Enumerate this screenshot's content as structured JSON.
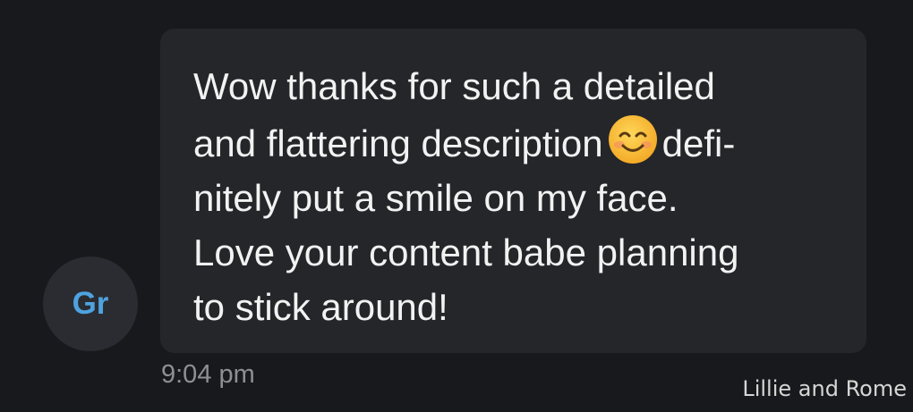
{
  "avatar": {
    "initials": "Gr",
    "color": "#4da3e0"
  },
  "message": {
    "lines": [
      "Wow thanks for such a detailed",
      "and flattering description",
      "defi-",
      "nitely put a smile on my face.",
      "Love your content babe planning",
      "to stick around!"
    ],
    "emoji": "smiling-face-with-smiling-eyes-icon",
    "timestamp": "9:04 pm"
  },
  "watermark": "Lillie and Rome",
  "colors": {
    "background": "#18191c",
    "bubble": "#25262a",
    "text": "#f2f2f2",
    "timestamp": "#8e8f93"
  }
}
